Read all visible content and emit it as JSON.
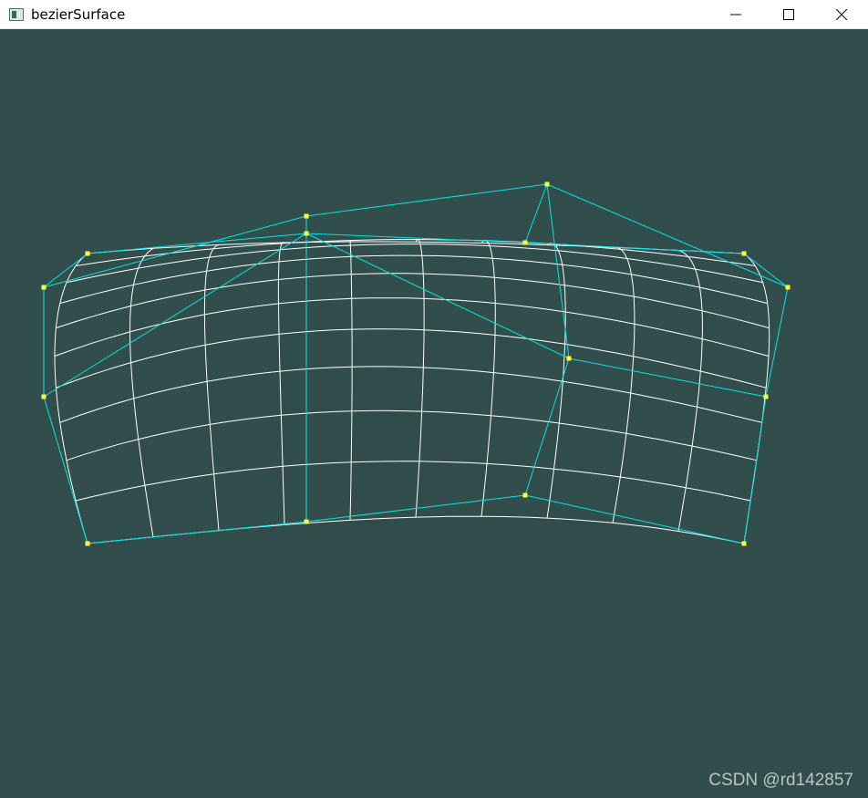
{
  "window": {
    "title": "bezierSurface",
    "controls": [
      "minimize",
      "maximize",
      "close"
    ]
  },
  "viewport": {
    "background_color": "#324e4c",
    "mesh_color": "#ffffff",
    "control_net_color": "#00e5e5",
    "control_point_color": "#ffff33"
  },
  "watermark": "CSDN @rd142857"
}
